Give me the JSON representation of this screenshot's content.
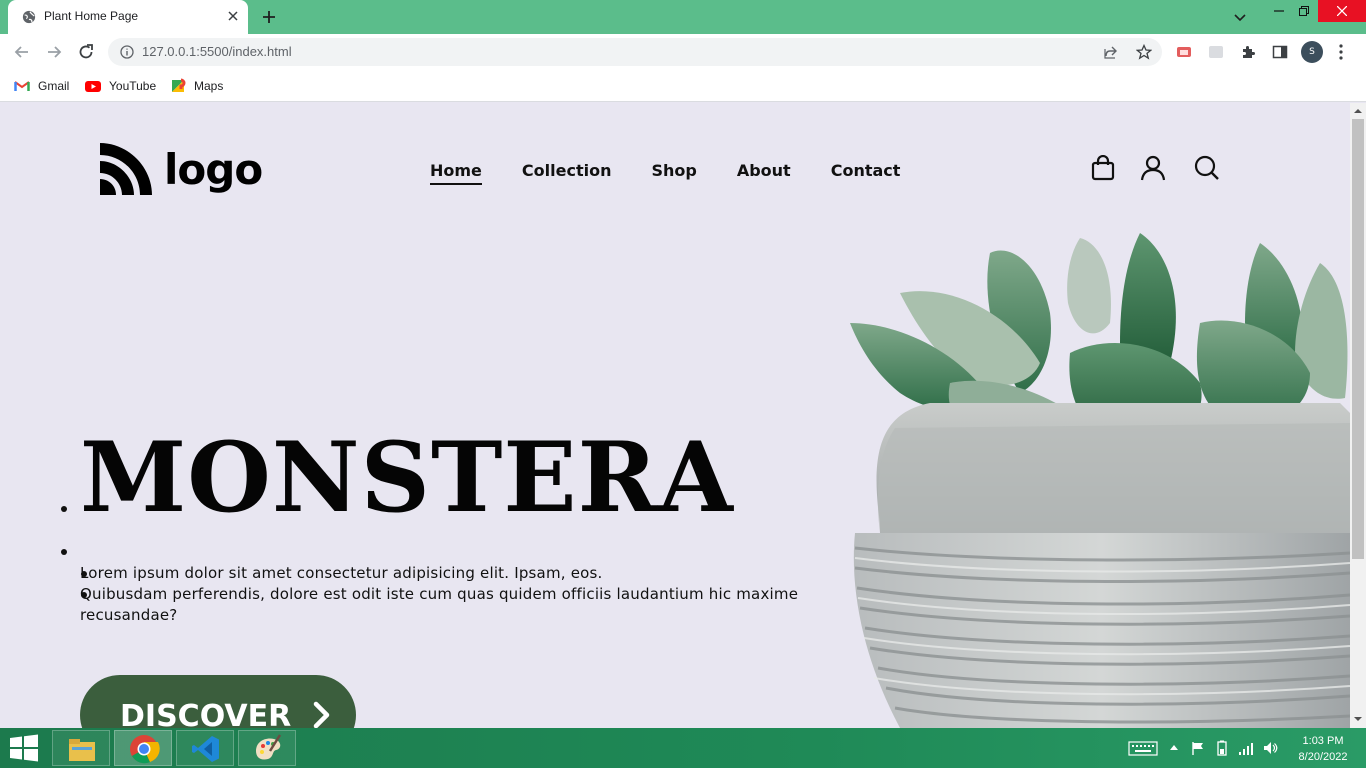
{
  "browser": {
    "tab_title": "Plant Home Page",
    "url": "127.0.0.1:5500/index.html",
    "profile_initial": "S",
    "bookmarks": [
      {
        "label": "Gmail",
        "icon": "gmail-icon"
      },
      {
        "label": "YouTube",
        "icon": "youtube-icon"
      },
      {
        "label": "Maps",
        "icon": "maps-icon"
      }
    ]
  },
  "site": {
    "logo_text": "logo",
    "nav": [
      "Home",
      "Collection",
      "Shop",
      "About",
      "Contact"
    ],
    "active_nav": "Home",
    "header_icons": [
      "bag-icon",
      "user-icon",
      "search-icon"
    ],
    "hero": {
      "title": "MONSTERA",
      "lines": [
        "Lorem ipsum dolor sit amet consectetur adipisicing elit. Ipsam, eos.",
        "Quibusdam perferendis, dolore est odit iste cum quas quidem officiis laudantium hic maxime recusandae?"
      ],
      "button_label": "DISCOVER"
    }
  },
  "taskbar": {
    "apps": [
      "file-explorer-icon",
      "chrome-icon",
      "vscode-icon",
      "paint-icon"
    ],
    "active_app": "chrome-icon",
    "time": "1:03 PM",
    "date": "8/20/2022"
  },
  "colors": {
    "titlebar": "#5bbd8b",
    "page_bg": "#e8e6f1",
    "button_green": "#3b5e3d",
    "taskbar": "#1f8a57"
  }
}
